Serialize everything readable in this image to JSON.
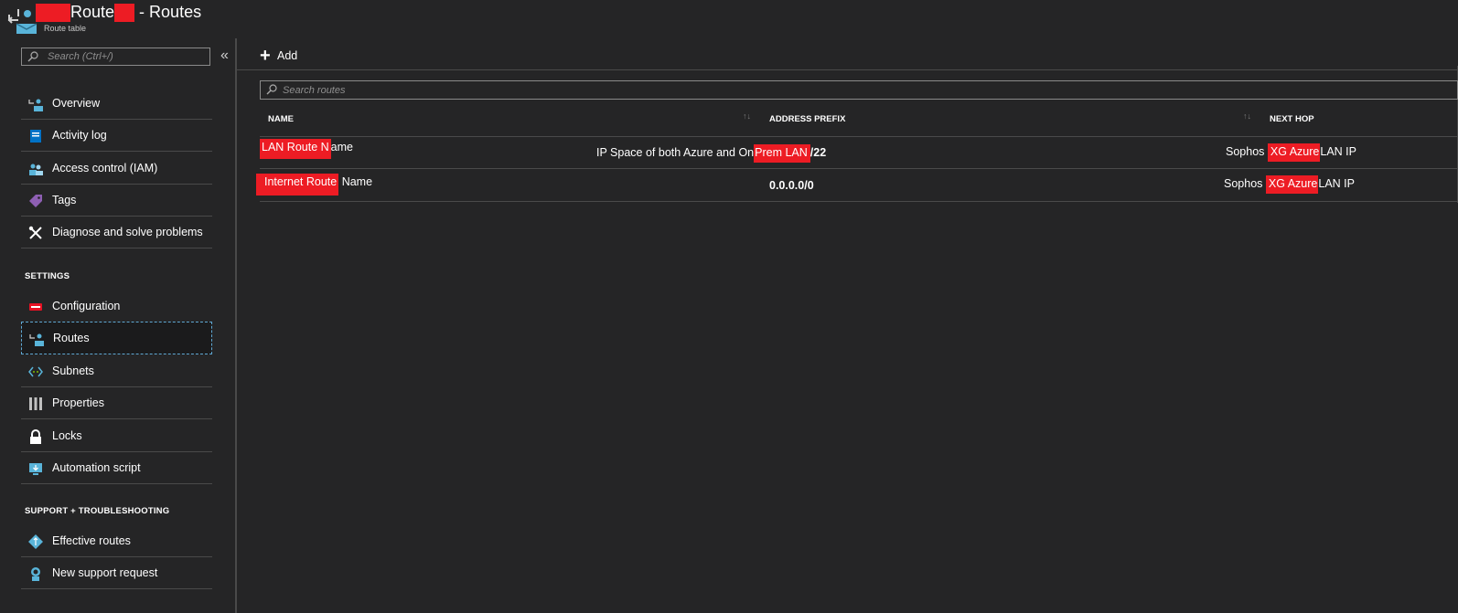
{
  "header": {
    "title_part1": "Route",
    "title_part2": " - Routes",
    "subtitle": "Route table"
  },
  "sidebar": {
    "search_placeholder": "Search (Ctrl+/)",
    "collapse_glyph": "«",
    "items": [
      {
        "label": "Overview",
        "icon": "route-table-icon"
      },
      {
        "label": "Activity log",
        "icon": "activity-log-icon"
      },
      {
        "label": "Access control (IAM)",
        "icon": "people-icon"
      },
      {
        "label": "Tags",
        "icon": "tag-icon"
      },
      {
        "label": "Diagnose and solve problems",
        "icon": "wrench-icon"
      }
    ],
    "settings_heading": "SETTINGS",
    "settings_items": [
      {
        "label": "Configuration",
        "icon": "configuration-icon"
      },
      {
        "label": "Routes",
        "icon": "route-table-icon",
        "active": true
      },
      {
        "label": "Subnets",
        "icon": "subnet-icon"
      },
      {
        "label": "Properties",
        "icon": "properties-icon"
      },
      {
        "label": "Locks",
        "icon": "lock-icon"
      },
      {
        "label": "Automation script",
        "icon": "automation-icon"
      }
    ],
    "support_heading": "SUPPORT + TROUBLESHOOTING",
    "support_items": [
      {
        "label": "Effective routes",
        "icon": "effective-routes-icon"
      },
      {
        "label": "New support request",
        "icon": "support-icon"
      }
    ]
  },
  "main": {
    "add_label": "Add",
    "search_placeholder": "Search routes",
    "columns": [
      "NAME",
      "ADDRESS PREFIX",
      "NEXT HOP"
    ],
    "sort_glyph": "↑↓",
    "rows": [
      {
        "name_redacted": "LAN Route N",
        "name_rest": "ame",
        "prefix_before": "IP Space of both Azure and On",
        "prefix_redacted": "Prem LAN",
        "prefix_after": "/22",
        "hop_before": "Sophos ",
        "hop_redacted": "XG Azure",
        "hop_after": "LAN IP"
      },
      {
        "name_redacted": "Internet Route",
        "name_rest": " Name",
        "prefix": "0.0.0.0/0",
        "hop_before": "Sophos ",
        "hop_redacted": "XG Azure",
        "hop_after": "LAN IP"
      }
    ]
  },
  "colors": {
    "background": "#252526",
    "divider": "#4a4a4a",
    "redaction": "#ed1c24",
    "active_border": "#5fa8d3"
  }
}
